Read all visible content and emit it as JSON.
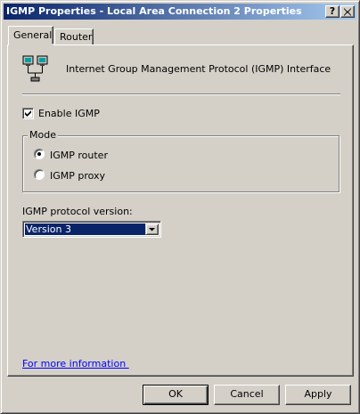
{
  "window": {
    "title": "IGMP Properties - Local Area Connection 2 Properties",
    "help_button": "?",
    "close_button": "X"
  },
  "tabs": [
    {
      "label": "General",
      "active": true
    },
    {
      "label": "Router",
      "active": false
    }
  ],
  "general": {
    "header_icon": "network-connection-icon",
    "header_text": "Internet Group Management Protocol (IGMP) Interface",
    "enable_igmp": {
      "label": "Enable IGMP",
      "checked": true
    },
    "mode": {
      "label": "Mode",
      "options": [
        {
          "label": "IGMP router",
          "selected": true
        },
        {
          "label": "IGMP proxy",
          "selected": false
        }
      ]
    },
    "version": {
      "label": "IGMP protocol version:",
      "selected": "Version 3"
    },
    "more_info_link": "For more information "
  },
  "buttons": {
    "ok": "OK",
    "cancel": "Cancel",
    "apply": "Apply"
  },
  "colors": {
    "face": "#d4d0c8",
    "title_start": "#0a246a",
    "title_end": "#a6caf0",
    "selection": "#0a246a",
    "link": "#0000ff"
  }
}
